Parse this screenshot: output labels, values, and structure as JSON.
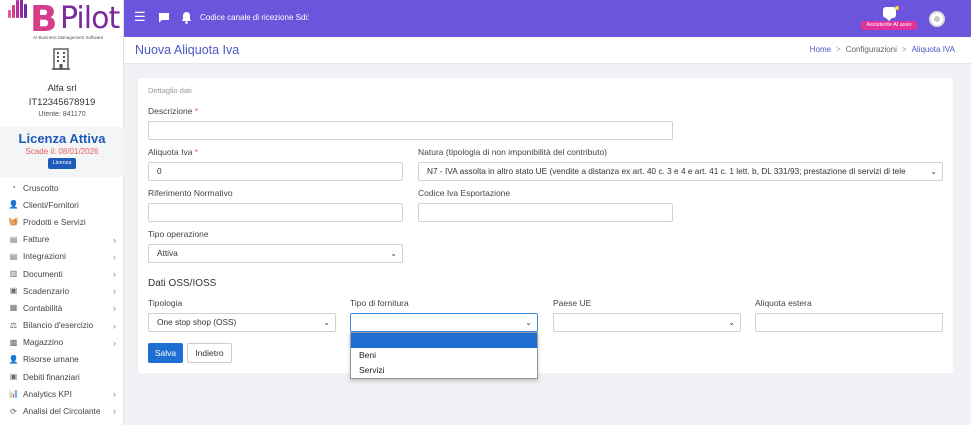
{
  "sidebar": {
    "logo": {
      "letter": "B",
      "word": "Pilot",
      "subtitle": "AI Business Management Software"
    },
    "company_name": "Alfa srl",
    "vat": "IT12345678919",
    "user": "Utente: 841170",
    "license_title": "Licenza Attiva",
    "license_expiry": "Scade il: 08/01/2026",
    "license_button": "Licenza",
    "menu": [
      {
        "label": "Cruscotto",
        "icon": "dashboard-icon",
        "glyph": "◔",
        "has_submenu": false
      },
      {
        "label": "Clienti/Fornitori",
        "icon": "user-icon",
        "glyph": "👤",
        "has_submenu": false
      },
      {
        "label": "Prodotti e Servizi",
        "icon": "basket-icon",
        "glyph": "🧺",
        "has_submenu": false
      },
      {
        "label": "Fatture",
        "icon": "invoice-icon",
        "glyph": "▤",
        "has_submenu": true
      },
      {
        "label": "Integrazioni",
        "icon": "document-icon",
        "glyph": "▤",
        "has_submenu": true
      },
      {
        "label": "Documenti",
        "icon": "documents-icon",
        "glyph": "▥",
        "has_submenu": true
      },
      {
        "label": "Scadenzario",
        "icon": "cash-icon",
        "glyph": "▣",
        "has_submenu": true
      },
      {
        "label": "Contabilità",
        "icon": "book-icon",
        "glyph": "▦",
        "has_submenu": true
      },
      {
        "label": "Bilancio d'esercizio",
        "icon": "balance-icon",
        "glyph": "⚖",
        "has_submenu": true
      },
      {
        "label": "Magazzino",
        "icon": "warehouse-icon",
        "glyph": "▩",
        "has_submenu": true
      },
      {
        "label": "Risorse umane",
        "icon": "people-icon",
        "glyph": "👤",
        "has_submenu": false
      },
      {
        "label": "Debiti finanziari",
        "icon": "money-icon",
        "glyph": "▣",
        "has_submenu": false
      },
      {
        "label": "Analytics KPI",
        "icon": "chart-icon",
        "glyph": "📊",
        "has_submenu": true
      },
      {
        "label": "Analisi del Circolante",
        "icon": "refresh-icon",
        "glyph": "⟳",
        "has_submenu": true
      }
    ]
  },
  "topbar": {
    "channel_text": "Codice canale di ricezione Sdi:",
    "assistant_label": "Assistente AI asso",
    "color": "#6b55dc"
  },
  "header": {
    "title": "Nuova Aliquota Iva",
    "breadcrumb": [
      "Home",
      "Configurazioni",
      "Aliquota IVA"
    ]
  },
  "form": {
    "section_detail": "Dettaglio dati",
    "descrizione_label": "Descrizione",
    "descrizione_value": "",
    "aliquota_label": "Aliquota Iva",
    "aliquota_value": "0",
    "natura_label": "Natura (tipologia di non imponibilità del contributo)",
    "natura_value": "N7 - IVA assolta in altro stato UE (vendite a distanza ex art. 40 c. 3 e 4 e art. 41 c. 1 lett. b, DL 331/93; prestazione di servizi di tele",
    "riferimento_label": "Riferimento Normativo",
    "riferimento_value": "",
    "codice_label": "Codice Iva Esportazione",
    "codice_value": "",
    "tipo_operazione_label": "Tipo operazione",
    "tipo_operazione_value": "Attiva",
    "section_oss": "Dati OSS/IOSS",
    "tipologia_label": "Tipologia",
    "tipologia_value": "One stop shop (OSS)",
    "fornitura_label": "Tipo di fornitura",
    "fornitura_value": "",
    "paese_label": "Paese UE",
    "paese_value": "",
    "aliquota_estera_label": "Aliquota estera",
    "aliquota_estera_value": "",
    "required_mark": "*",
    "save_label": "Salva",
    "back_label": "Indietro"
  },
  "dropdown": {
    "options": [
      "",
      "Beni",
      "Servizi"
    ]
  }
}
